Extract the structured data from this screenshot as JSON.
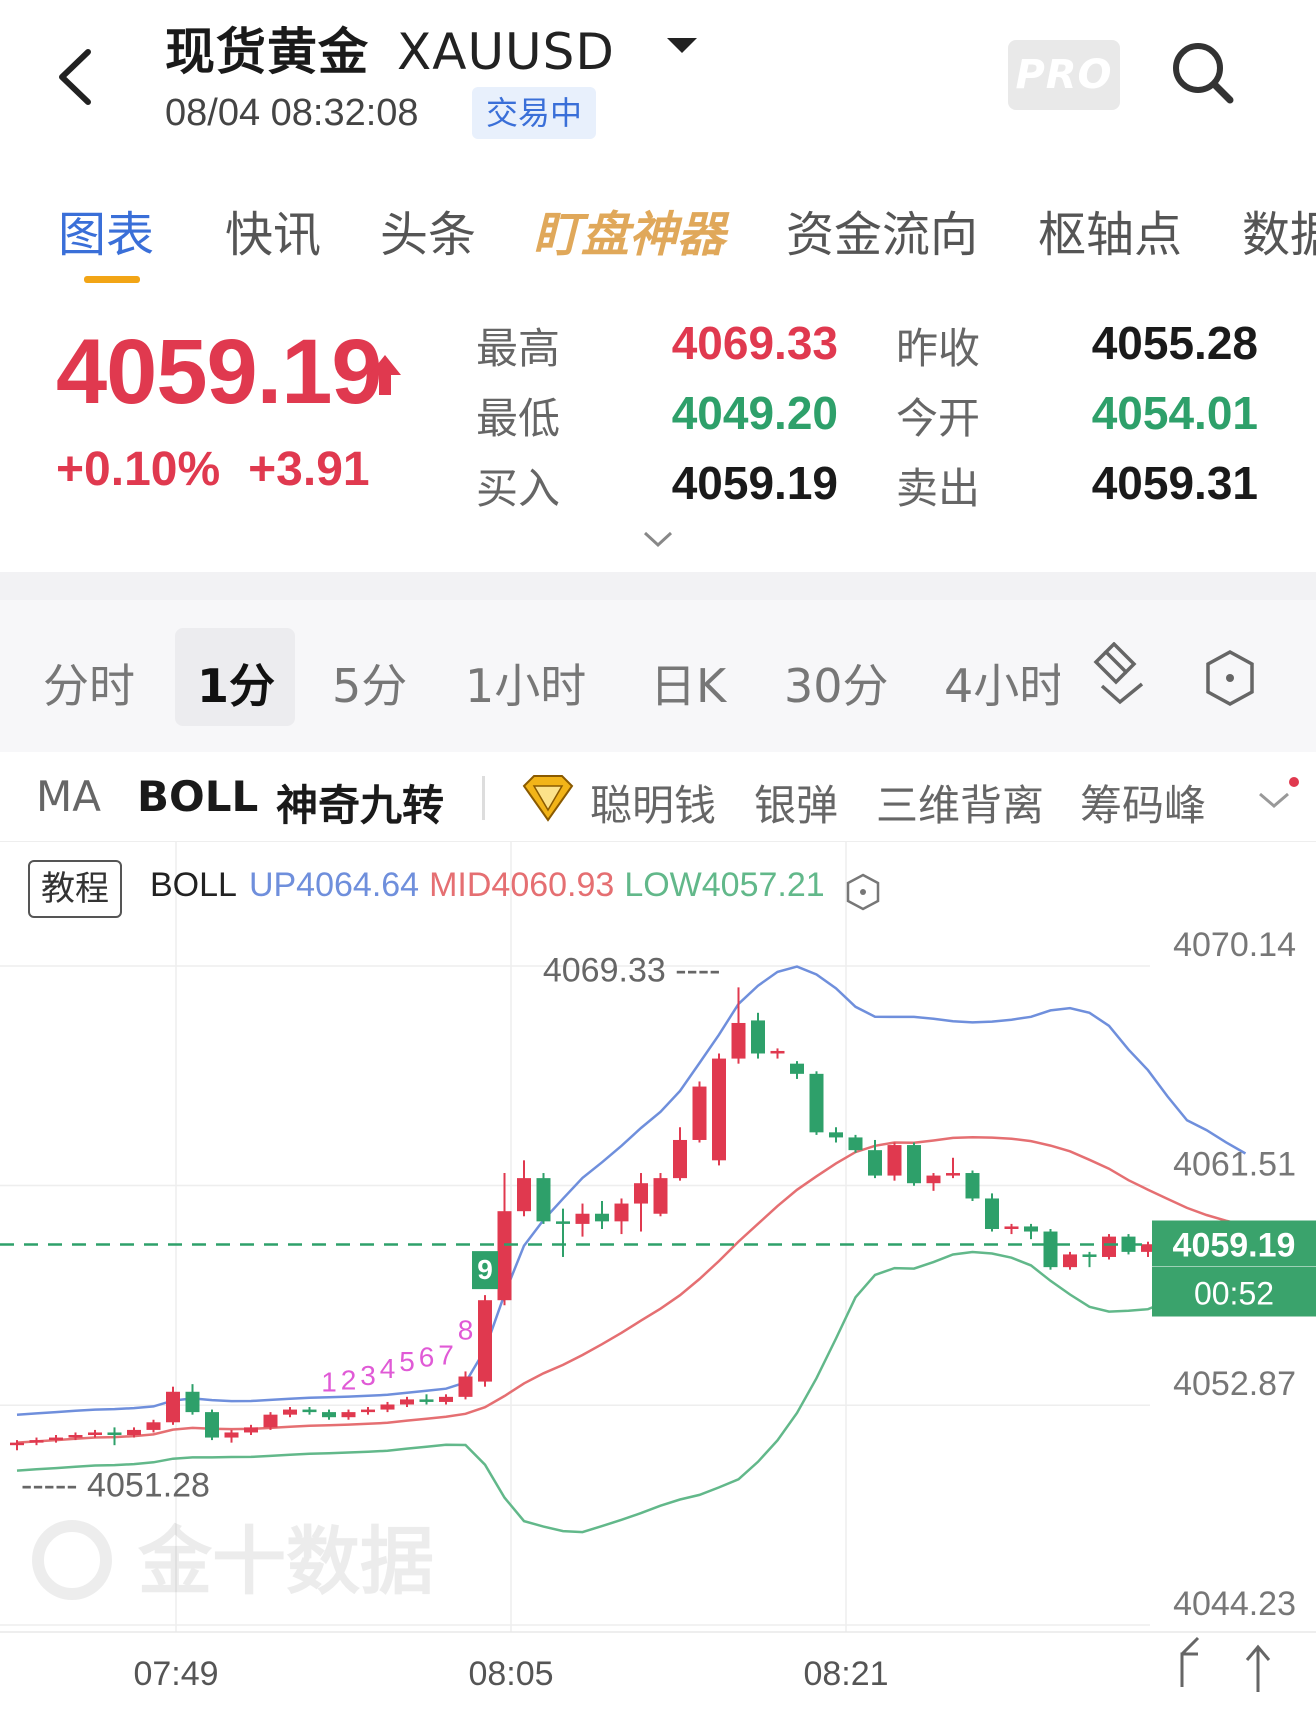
{
  "header": {
    "title": "现货黄金",
    "symbol": "XAUUSD",
    "time": "08/04 08:32:08",
    "status": "交易中",
    "pro_label": "PRO"
  },
  "main_tabs": [
    {
      "label": "图表",
      "active": true
    },
    {
      "label": "快讯"
    },
    {
      "label": "头条"
    },
    {
      "label": "盯盘神器",
      "highlight": true
    },
    {
      "label": "资金流向"
    },
    {
      "label": "枢轴点"
    },
    {
      "label": "数据"
    }
  ],
  "quote": {
    "price": "4059.19",
    "change_pct": "+0.10%",
    "change": "+3.91",
    "high_label": "最高",
    "high": "4069.33",
    "low_label": "最低",
    "low": "4049.20",
    "bid_label": "买入",
    "bid": "4059.19",
    "prev_close_label": "昨收",
    "prev_close": "4055.28",
    "open_label": "今开",
    "open": "4054.01",
    "ask_label": "卖出",
    "ask": "4059.31"
  },
  "period_tabs": [
    "分时",
    "1分",
    "5分",
    "1小时",
    "日K",
    "30分",
    "4小时"
  ],
  "period_active": "1分",
  "indicators": [
    "MA",
    "BOLL",
    "神奇九转",
    "聪明钱",
    "银弹",
    "三维背离",
    "筹码峰"
  ],
  "chart_header": {
    "tutorial": "教程",
    "boll_label": "BOLL",
    "up": "UP4064.64",
    "mid": "MID4060.93",
    "low": "LOW4057.21"
  },
  "colors": {
    "up": "#e0394f",
    "down": "#2ea06a",
    "boll_up": "#6f8fdc",
    "boll_mid": "#e56f72",
    "boll_low": "#62b88a",
    "accent": "#3a6fd8"
  },
  "chart_data": {
    "type": "candlestick",
    "y_ticks": [
      "4070.14",
      "4061.51",
      "4052.87",
      "4044.23"
    ],
    "x_ticks": [
      "07:49",
      "08:05",
      "08:21"
    ],
    "ylim": [
      4044.23,
      4070.14
    ],
    "current_price": "4059.19",
    "countdown": "00:52",
    "high_marker": "4069.33",
    "low_marker": "4051.28",
    "td_sequence": [
      "1",
      "2",
      "3",
      "4",
      "5",
      "6",
      "7",
      "8",
      "9"
    ],
    "watermark": "金十数据",
    "candles": [
      [
        4051.3,
        4051.4,
        4051.1,
        4051.5
      ],
      [
        4051.4,
        4051.5,
        4051.3,
        4051.6
      ],
      [
        4051.5,
        4051.6,
        4051.4,
        4051.7
      ],
      [
        4051.6,
        4051.7,
        4051.5,
        4051.8
      ],
      [
        4051.7,
        4051.8,
        4051.6,
        4051.9
      ],
      [
        4051.8,
        4051.7,
        4051.3,
        4052.0
      ],
      [
        4051.7,
        4051.9,
        4051.6,
        4052.0
      ],
      [
        4051.9,
        4052.2,
        4051.8,
        4052.3
      ],
      [
        4052.2,
        4053.4,
        4052.1,
        4053.6
      ],
      [
        4053.4,
        4052.6,
        4052.5,
        4053.7
      ],
      [
        4052.6,
        4051.6,
        4051.5,
        4052.7
      ],
      [
        4051.6,
        4051.8,
        4051.4,
        4051.9
      ],
      [
        4051.8,
        4052.0,
        4051.7,
        4052.1
      ],
      [
        4052.0,
        4052.5,
        4051.9,
        4052.6
      ],
      [
        4052.5,
        4052.7,
        4052.4,
        4052.8
      ],
      [
        4052.7,
        4052.6,
        4052.5,
        4052.8
      ],
      [
        4052.6,
        4052.4,
        4052.3,
        4052.7
      ],
      [
        4052.4,
        4052.6,
        4052.3,
        4052.7
      ],
      [
        4052.6,
        4052.7,
        4052.5,
        4052.8
      ],
      [
        4052.7,
        4052.9,
        4052.6,
        4053.0
      ],
      [
        4052.9,
        4053.1,
        4052.8,
        4053.2
      ],
      [
        4053.1,
        4053.0,
        4052.9,
        4053.3
      ],
      [
        4053.0,
        4053.2,
        4052.9,
        4053.3
      ],
      [
        4053.2,
        4054.0,
        4053.1,
        4054.2
      ],
      [
        4053.8,
        4057.0,
        4053.6,
        4057.2
      ],
      [
        4057.0,
        4060.5,
        4056.8,
        4062.0
      ],
      [
        4060.5,
        4061.8,
        4060.3,
        4062.5
      ],
      [
        4061.8,
        4060.1,
        4060.0,
        4062.0
      ],
      [
        4060.1,
        4060.0,
        4058.7,
        4060.6
      ],
      [
        4060.0,
        4060.4,
        4059.5,
        4060.8
      ],
      [
        4060.4,
        4060.1,
        4059.8,
        4060.9
      ],
      [
        4060.1,
        4060.8,
        4059.6,
        4061.0
      ],
      [
        4060.8,
        4061.6,
        4059.7,
        4062.0
      ],
      [
        4060.4,
        4061.8,
        4060.3,
        4062.0
      ],
      [
        4061.8,
        4063.3,
        4061.7,
        4063.8
      ],
      [
        4063.3,
        4065.4,
        4063.2,
        4065.6
      ],
      [
        4062.5,
        4066.5,
        4062.3,
        4066.7
      ],
      [
        4066.5,
        4067.9,
        4066.3,
        4069.3
      ],
      [
        4068.0,
        4066.7,
        4066.5,
        4068.3
      ],
      [
        4066.7,
        4066.8,
        4066.5,
        4066.9
      ],
      [
        4066.3,
        4065.9,
        4065.7,
        4066.4
      ],
      [
        4065.9,
        4063.6,
        4063.5,
        4066.0
      ],
      [
        4063.6,
        4063.4,
        4063.2,
        4063.8
      ],
      [
        4063.4,
        4062.9,
        4062.8,
        4063.5
      ],
      [
        4062.9,
        4061.9,
        4061.8,
        4063.3
      ],
      [
        4061.9,
        4063.1,
        4061.7,
        4063.2
      ],
      [
        4063.1,
        4061.6,
        4061.5,
        4063.2
      ],
      [
        4061.6,
        4061.9,
        4061.3,
        4062.0
      ],
      [
        4061.9,
        4062.0,
        4061.8,
        4062.6
      ],
      [
        4062.0,
        4061.0,
        4060.9,
        4062.1
      ],
      [
        4061.0,
        4059.8,
        4059.7,
        4061.2
      ],
      [
        4059.8,
        4059.9,
        4059.6,
        4060.0
      ],
      [
        4059.9,
        4059.7,
        4059.4,
        4060.0
      ],
      [
        4059.7,
        4058.3,
        4058.2,
        4059.8
      ],
      [
        4058.3,
        4058.8,
        4058.2,
        4058.9
      ],
      [
        4058.8,
        4058.7,
        4058.3,
        4058.9
      ],
      [
        4058.7,
        4059.5,
        4058.6,
        4059.6
      ],
      [
        4059.5,
        4058.9,
        4058.8,
        4059.6
      ],
      [
        4058.9,
        4059.2,
        4058.7,
        4059.3
      ],
      [
        4059.3,
        4059.6,
        4059.2,
        4059.7
      ],
      [
        4059.6,
        4058.8,
        4058.6,
        4059.7
      ],
      [
        4058.8,
        4058.0,
        4057.9,
        4059.0
      ],
      [
        4058.0,
        4058.9,
        4057.9,
        4059.5
      ],
      [
        4058.9,
        4059.2,
        4058.8,
        4059.3
      ]
    ]
  }
}
